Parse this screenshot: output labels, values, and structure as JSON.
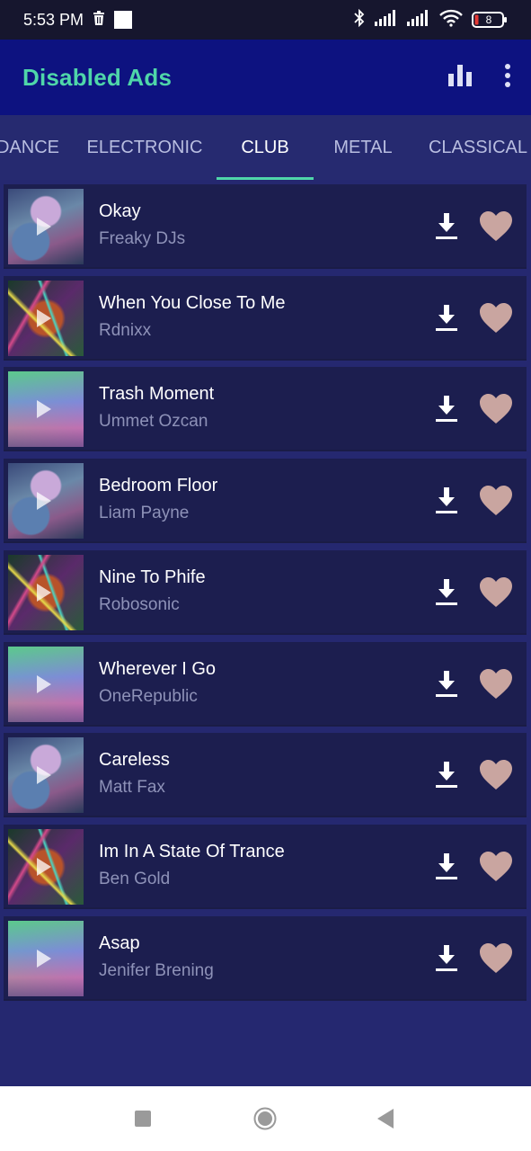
{
  "status": {
    "time": "5:53 PM",
    "battery": "8"
  },
  "appbar": {
    "title": "Disabled Ads",
    "actions": [
      "equalizer-icon",
      "more-vert-icon"
    ]
  },
  "tabs": [
    {
      "label": "DANCE",
      "active": false
    },
    {
      "label": "ELECTRONIC",
      "active": false
    },
    {
      "label": "CLUB",
      "active": true
    },
    {
      "label": "METAL",
      "active": false
    },
    {
      "label": "CLASSICAL",
      "active": false
    }
  ],
  "tracks": [
    {
      "title": "Okay",
      "artist": "Freaky DJs",
      "cover": "t-a"
    },
    {
      "title": "When You Close To Me",
      "artist": "Rdnixx",
      "cover": "t-b"
    },
    {
      "title": "Trash Moment",
      "artist": "Ummet Ozcan",
      "cover": "t-c"
    },
    {
      "title": "Bedroom Floor",
      "artist": "Liam Payne",
      "cover": "t-a"
    },
    {
      "title": "Nine To Phife",
      "artist": "Robosonic",
      "cover": "t-b"
    },
    {
      "title": "Wherever I Go",
      "artist": "OneRepublic",
      "cover": "t-c"
    },
    {
      "title": "Careless",
      "artist": "Matt Fax",
      "cover": "t-a"
    },
    {
      "title": "Im In A State Of Trance",
      "artist": "Ben Gold",
      "cover": "t-b"
    },
    {
      "title": "Asap",
      "artist": "Jenifer Brening",
      "cover": "t-c"
    }
  ],
  "colors": {
    "accent": "#4fd6a9",
    "appbar": "#0d1280",
    "background": "#252870",
    "row": "#1c1e4f",
    "heart": "#c9a5a0"
  },
  "navbar": [
    "recents-square-icon",
    "home-circle-icon",
    "back-triangle-icon"
  ]
}
